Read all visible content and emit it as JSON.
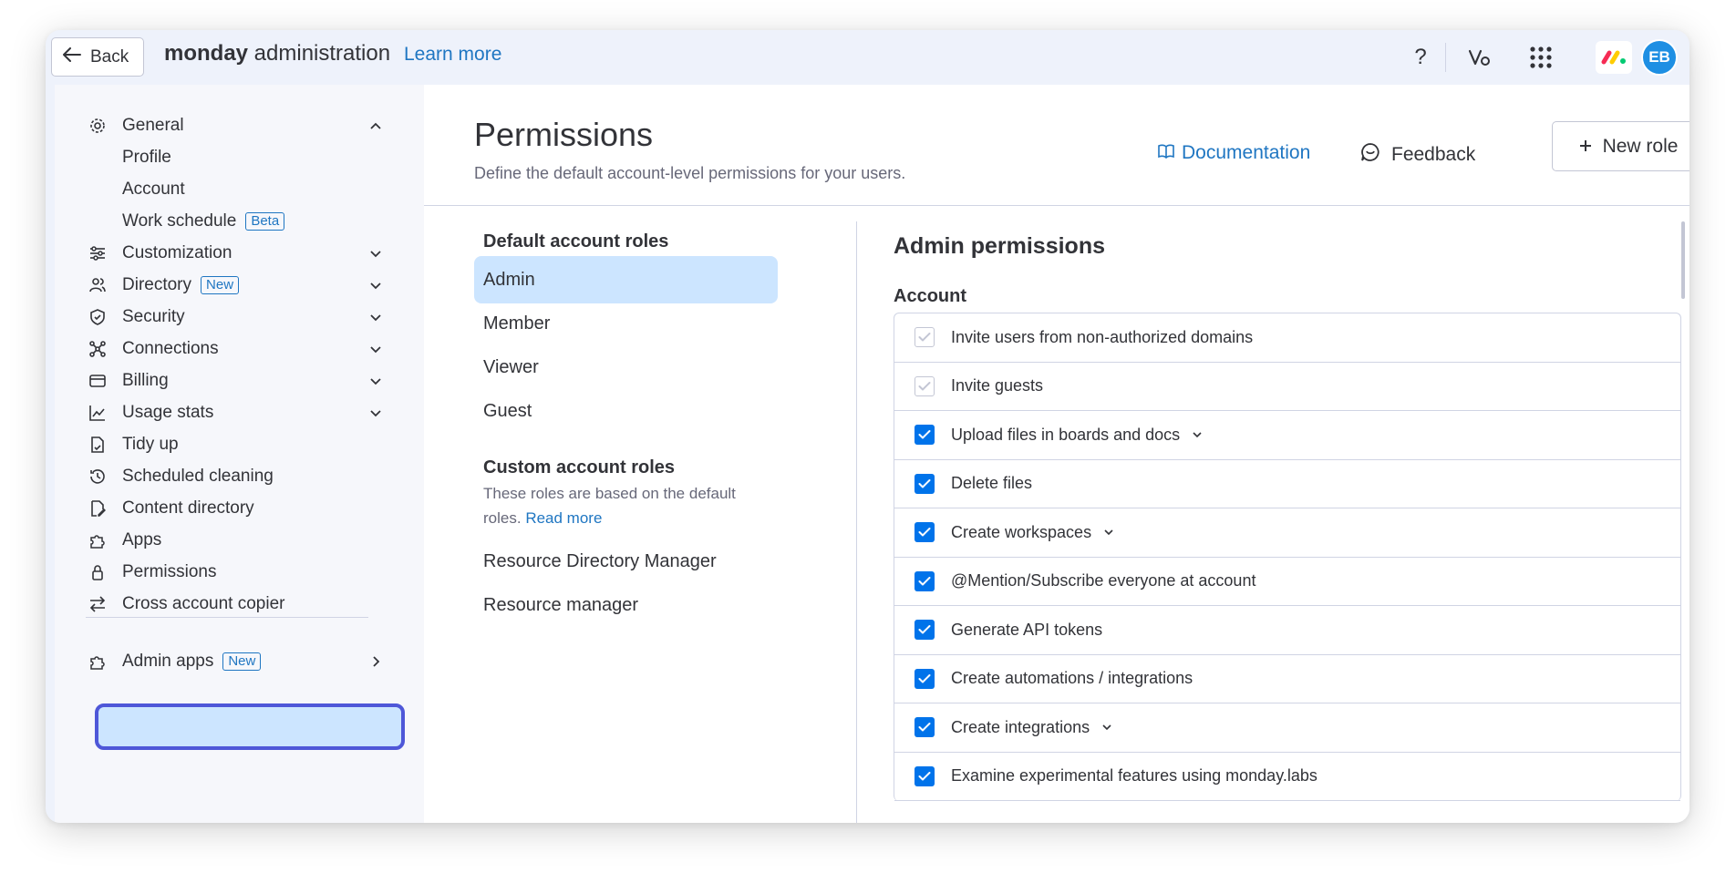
{
  "topbar": {
    "back_label": "Back",
    "title_bold": "monday",
    "title_rest": " administration",
    "learn_more": "Learn more",
    "help": "?",
    "avatar_initials": "EB"
  },
  "sidebar": {
    "general": "General",
    "general_sub": [
      "Profile",
      "Account",
      "Work schedule"
    ],
    "beta_badge": "Beta",
    "items": [
      {
        "label": "Customization"
      },
      {
        "label": "Directory",
        "badge": "New"
      },
      {
        "label": "Security"
      },
      {
        "label": "Connections"
      },
      {
        "label": "Billing"
      },
      {
        "label": "Usage stats"
      },
      {
        "label": "Tidy up"
      },
      {
        "label": "Scheduled cleaning"
      },
      {
        "label": "Content directory"
      },
      {
        "label": "Apps"
      },
      {
        "label": "Permissions"
      },
      {
        "label": "Cross account copier"
      }
    ],
    "admin_apps": "Admin apps",
    "admin_apps_badge": "New"
  },
  "header": {
    "title": "Permissions",
    "subtitle": "Define the default account-level permissions for your users.",
    "documentation": "Documentation",
    "feedback": "Feedback",
    "new_role": "New role"
  },
  "roles": {
    "default_title": "Default account roles",
    "default_roles": [
      "Admin",
      "Member",
      "Viewer",
      "Guest"
    ],
    "custom_title": "Custom account roles",
    "custom_note": "These roles are based on the default roles.",
    "read_more": "Read more",
    "custom_roles": [
      "Resource Directory Manager",
      "Resource manager"
    ]
  },
  "permissions": {
    "title": "Admin permissions",
    "section": "Account",
    "rows": [
      {
        "label": "Invite users from non-authorized domains",
        "state": "disabled",
        "dropdown": false
      },
      {
        "label": "Invite guests",
        "state": "disabled",
        "dropdown": false
      },
      {
        "label": "Upload files in boards and docs",
        "state": "checked",
        "dropdown": true
      },
      {
        "label": "Delete files",
        "state": "checked",
        "dropdown": false
      },
      {
        "label": "Create workspaces",
        "state": "checked",
        "dropdown": true
      },
      {
        "label": "@Mention/Subscribe everyone at account",
        "state": "checked",
        "dropdown": false
      },
      {
        "label": "Generate API tokens",
        "state": "checked",
        "dropdown": false
      },
      {
        "label": "Create automations / integrations",
        "state": "checked",
        "dropdown": false
      },
      {
        "label": "Create integrations",
        "state": "checked",
        "dropdown": true
      },
      {
        "label": "Examine experimental features using monday.labs",
        "state": "checked",
        "dropdown": false
      }
    ]
  },
  "colors": {
    "accent": "#0073ea",
    "link": "#1f76c2",
    "selected_bg": "#cce5ff",
    "focus_ring": "#4e57d8"
  }
}
